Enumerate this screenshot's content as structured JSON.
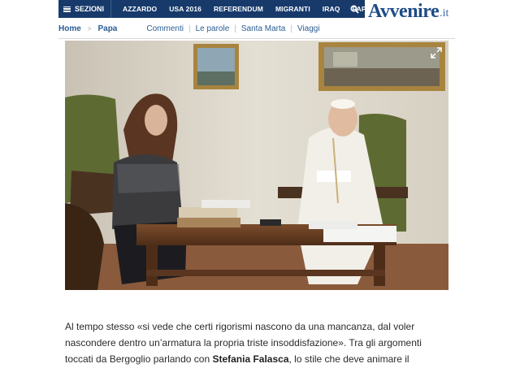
{
  "nav": {
    "sezioni_label": "SEZIONI",
    "links": [
      "AZZARDO",
      "USA 2016",
      "REFERENDUM",
      "MIGRANTI",
      "IRAQ",
      "PAPA"
    ],
    "search_icon": "search-icon"
  },
  "logo": {
    "name": "Avvenire",
    "tld": ".it"
  },
  "breadcrumb": {
    "home": "Home",
    "section": "Papa"
  },
  "subnav": [
    "Commenti",
    "Le parole",
    "Santa Marta",
    "Viaggi"
  ],
  "article": {
    "line1": "Al tempo stesso «si vede che certi rigorismi nascono da una mancanza, dal voler",
    "line2": "nascondere dentro un’armatura la propria triste insoddisfazione». Tra gli argomenti",
    "line3_pre": "toccati da Bergoglio parlando con ",
    "line3_name": "Stefania Falasca",
    "line3_post": ", lo stile che deve animare il"
  },
  "colors": {
    "nav_bg": "#173a6b",
    "link": "#2a5d94",
    "logo": "#1d4b86"
  }
}
